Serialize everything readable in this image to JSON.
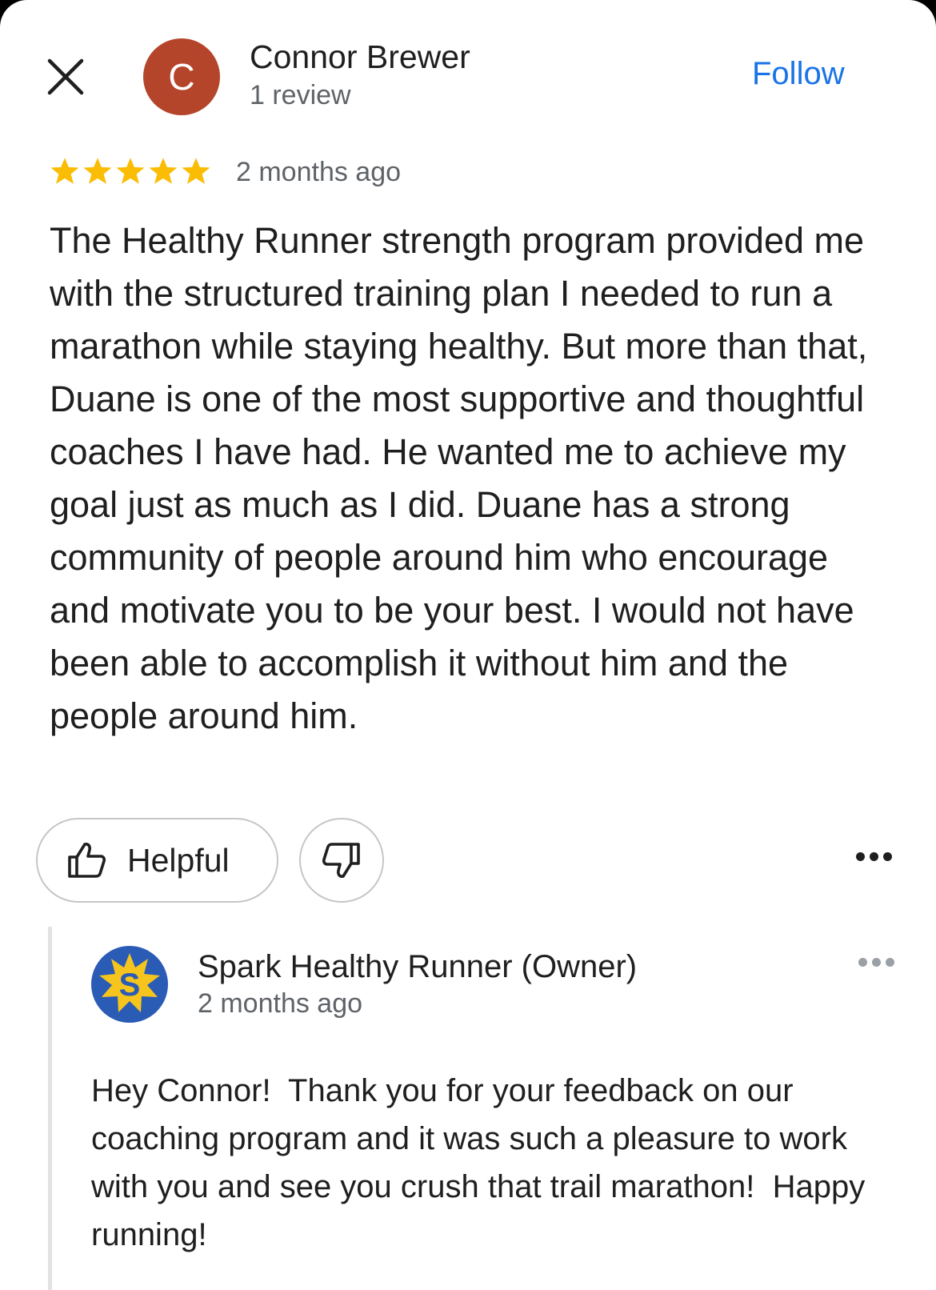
{
  "review": {
    "reviewer_initial": "C",
    "reviewer_name": "Connor Brewer",
    "review_count": "1 review",
    "follow_label": "Follow",
    "rating": 5,
    "time": "2 months ago",
    "text": "The Healthy Runner strength program provided me with the structured training plan I needed to run a marathon while staying healthy. But more than that, Duane is one of the most supportive and thoughtful coaches I have had. He wanted me to achieve my goal just as much as I did. Duane has a strong community of people around him who encourage and motivate you to be your best. I would not have been able to accomplish it without him and the people around him.",
    "helpful_label": "Helpful"
  },
  "owner_reply": {
    "logo_letter": "S",
    "name": "Spark Healthy Runner (Owner)",
    "time": "2 months ago",
    "text": "Hey Connor!  Thank you for your feedback on our coaching program and it was such a pleasure to work with you and see you crush that trail marathon!  Happy running!"
  },
  "colors": {
    "avatar_bg": "#b5452a",
    "link_blue": "#1a73e8",
    "star_yellow": "#fbbc04",
    "logo_blue": "#2a5bb5",
    "logo_yellow": "#f5c51e"
  },
  "icons": [
    "close-icon",
    "star-icon",
    "thumbs-up-icon",
    "thumbs-down-icon",
    "more-options-icon",
    "spark-logo"
  ]
}
